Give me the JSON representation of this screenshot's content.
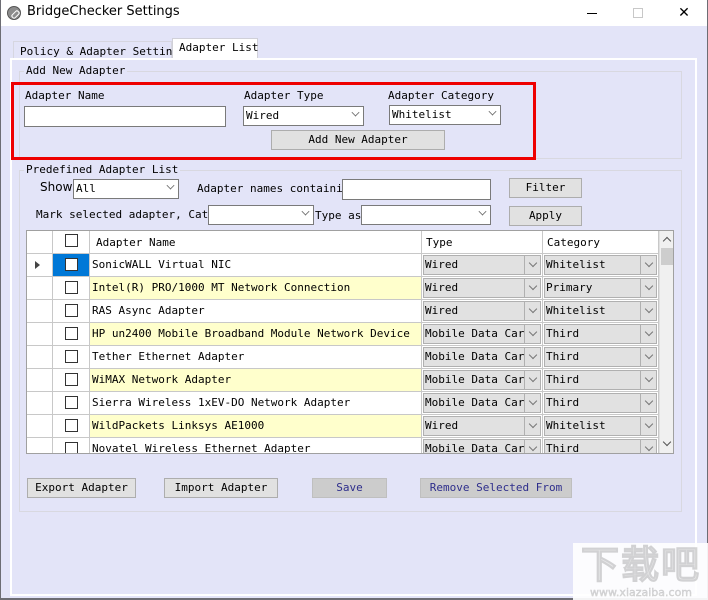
{
  "window": {
    "title": "BridgeChecker Settings",
    "app_icon": "link-icon",
    "controls": {
      "minimize": "minimize-icon",
      "maximize": "maximize-icon",
      "close": "close-icon"
    },
    "close_glyph": "✕"
  },
  "tabs": [
    {
      "label": "Policy & Adapter Settings",
      "active": false
    },
    {
      "label": "Adapter List",
      "active": true
    }
  ],
  "add_new_adapter": {
    "group_label": "Add New Adapter",
    "name_label": "Adapter Name",
    "name_value": "",
    "type_label": "Adapter Type",
    "type_value": "Wired",
    "category_label": "Adapter Category",
    "category_value": "Whitelist",
    "add_button": "Add New Adapter",
    "highlight_color": "#ee0000"
  },
  "predefined": {
    "group_label": "Predefined Adapter List",
    "show_label": "Show",
    "show_value": "All",
    "names_containing_label": "Adapter names containing",
    "names_containing_value": "",
    "filter_button": "Filter",
    "mark_label": "Mark selected adapter, Catego",
    "mark_category_value": "",
    "type_as_label": "Type as",
    "type_as_value": "",
    "apply_button": "Apply"
  },
  "grid": {
    "columns": {
      "name": "Adapter Name",
      "type": "Type",
      "category": "Category"
    },
    "alt_row_color": "#ffffcc",
    "selected_color": "#0078d7",
    "rows": [
      {
        "name": "SonicWALL Virtual NIC",
        "type": "Wired",
        "category": "Whitelist",
        "checked": false,
        "current": true
      },
      {
        "name": "Intel(R) PRO/1000 MT Network Connection",
        "type": "Wired",
        "category": "Primary",
        "checked": false
      },
      {
        "name": "RAS Async Adapter",
        "type": "Wired",
        "category": "Whitelist",
        "checked": false
      },
      {
        "name": "HP un2400 Mobile Broadband Module Network Device",
        "type": "Mobile Data Card",
        "category": "Third",
        "checked": false
      },
      {
        "name": "Tether Ethernet Adapter",
        "type": "Mobile Data Card",
        "category": "Third",
        "checked": false
      },
      {
        "name": "WiMAX Network Adapter",
        "type": "Mobile Data Card",
        "category": "Third",
        "checked": false
      },
      {
        "name": "Sierra Wireless 1xEV-DO Network Adapter",
        "type": "Mobile Data Card",
        "category": "Third",
        "checked": false
      },
      {
        "name": "WildPackets Linksys AE1000",
        "type": "Wired",
        "category": "Whitelist",
        "checked": false
      },
      {
        "name": "Novatel Wireless Ethernet Adapter",
        "type": "Mobile Data Card",
        "category": "Third",
        "checked": false
      }
    ]
  },
  "footer_buttons": {
    "export": "Export Adapter",
    "import": "Import Adapter",
    "save": "Save",
    "remove": "Remove Selected From"
  },
  "watermark": {
    "text": "下载吧",
    "url": "www.xiazaiba.com"
  }
}
